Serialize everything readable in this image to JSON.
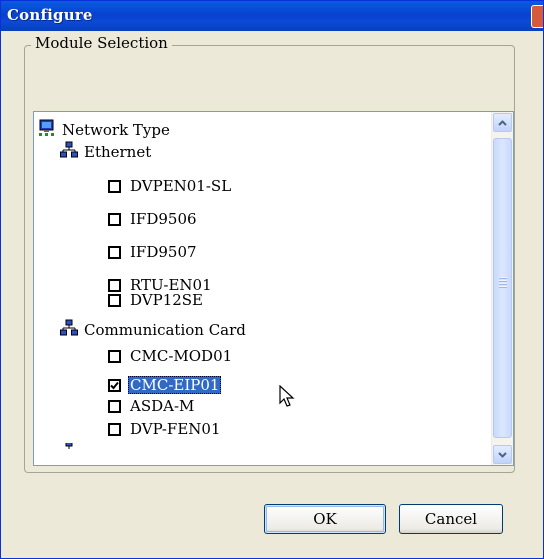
{
  "window": {
    "title": "Configure"
  },
  "group": {
    "title": "Module Selection"
  },
  "tree": {
    "root": "Network Type",
    "groups": [
      {
        "label": "Ethernet",
        "items": [
          {
            "label": "DVPEN01-SL",
            "checked": false
          },
          {
            "label": "IFD9506",
            "checked": false
          },
          {
            "label": "IFD9507",
            "checked": false
          },
          {
            "label": "RTU-EN01",
            "checked": false
          },
          {
            "label": "DVP12SE",
            "checked": false
          }
        ]
      },
      {
        "label": "Communication Card",
        "items": [
          {
            "label": "CMC-MOD01",
            "checked": false
          },
          {
            "label": "CMC-EIP01",
            "checked": true,
            "selected": true
          },
          {
            "label": "ASDA-M",
            "checked": false
          },
          {
            "label": "DVP-FEN01",
            "checked": false
          }
        ]
      }
    ]
  },
  "buttons": {
    "ok": "OK",
    "cancel": "Cancel"
  }
}
